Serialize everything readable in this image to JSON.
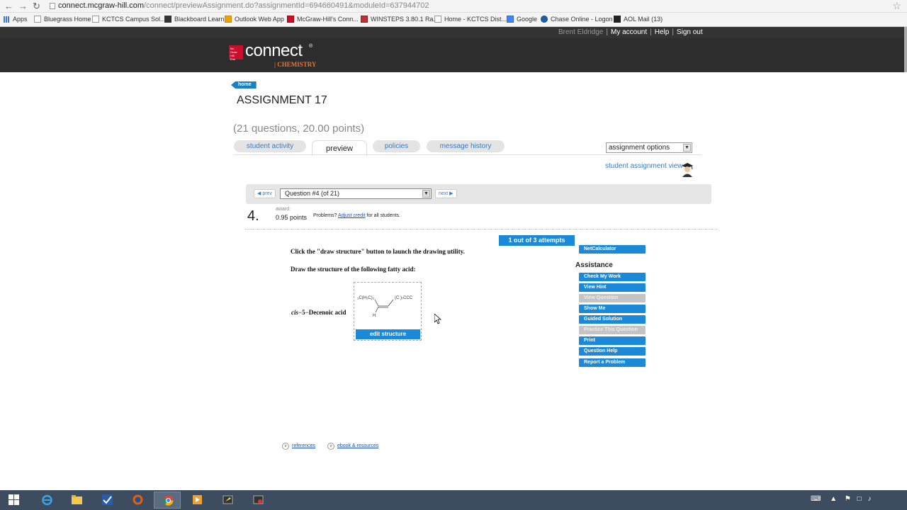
{
  "browser": {
    "url_host": "connect.mcgraw-hill.com",
    "url_path": "/connect/previewAssignment.do?assignmentId=694660491&moduleId=637944702",
    "bookmarks": [
      "Apps",
      "Bluegrass Home",
      "KCTCS Campus Sol...",
      "Blackboard Learn",
      "Outlook Web App",
      "McGraw-Hill's Conn...",
      "WINSTEPS 3.80.1 Ra...",
      "Home - KCTCS Dist...",
      "Google",
      "Chase Online - Logon",
      "AOL Mail (13)"
    ]
  },
  "topnav": {
    "user": "Brent Eldridge",
    "my_account": "My account",
    "help": "Help",
    "sign_out": "Sign out"
  },
  "brand": {
    "name": "connect",
    "subject": "CHEMISTRY"
  },
  "page": {
    "home": "home",
    "title": "ASSIGNMENT 17",
    "subtitle": "(21 questions, 20.00 points)",
    "tabs": [
      "student activity",
      "preview",
      "policies",
      "message history"
    ],
    "assignment_options": "assignment options",
    "student_view": "student assignment view"
  },
  "question_nav": {
    "prev": "prev",
    "next": "next",
    "selected": "Question #4 (of 21)"
  },
  "question": {
    "number": "4.",
    "award_label": "award:",
    "points": "0.95 points",
    "problems_text": "Problems?",
    "adjust_credit": "Adjust credit",
    "for_all": "for all students.",
    "attempts": "1 out of 3 attempts",
    "instruction1": "Click the \"draw structure\" button to launch the drawing utility.",
    "instruction2": "Draw the structure of the following fatty acid:",
    "compound_prefix": "cis",
    "compound_rest": "−5−Decenoic acid",
    "struct_left": "₃C(H₂C)₃",
    "struct_right": "(C  )₇CCC",
    "struct_h": "H",
    "edit_structure": "edit structure"
  },
  "assistance": {
    "calculator": "NetCalculator",
    "title": "Assistance",
    "buttons": [
      {
        "label": "Check My Work",
        "enabled": true
      },
      {
        "label": "View Hint",
        "enabled": true
      },
      {
        "label": "View Question",
        "enabled": false
      },
      {
        "label": "Show Me",
        "enabled": true
      },
      {
        "label": "Guided Solution",
        "enabled": true
      },
      {
        "label": "Practice This Question",
        "enabled": false
      },
      {
        "label": "Print",
        "enabled": true
      },
      {
        "label": "Question Help",
        "enabled": true
      },
      {
        "label": "Report a Problem",
        "enabled": true
      }
    ]
  },
  "footer": {
    "references": "references",
    "ebook": "ebook & resources"
  },
  "colors": {
    "accent_blue": "#1b88d8",
    "brand_red": "#c8102e",
    "brand_orange": "#e8762b",
    "header_dark": "#2d2d2d"
  }
}
